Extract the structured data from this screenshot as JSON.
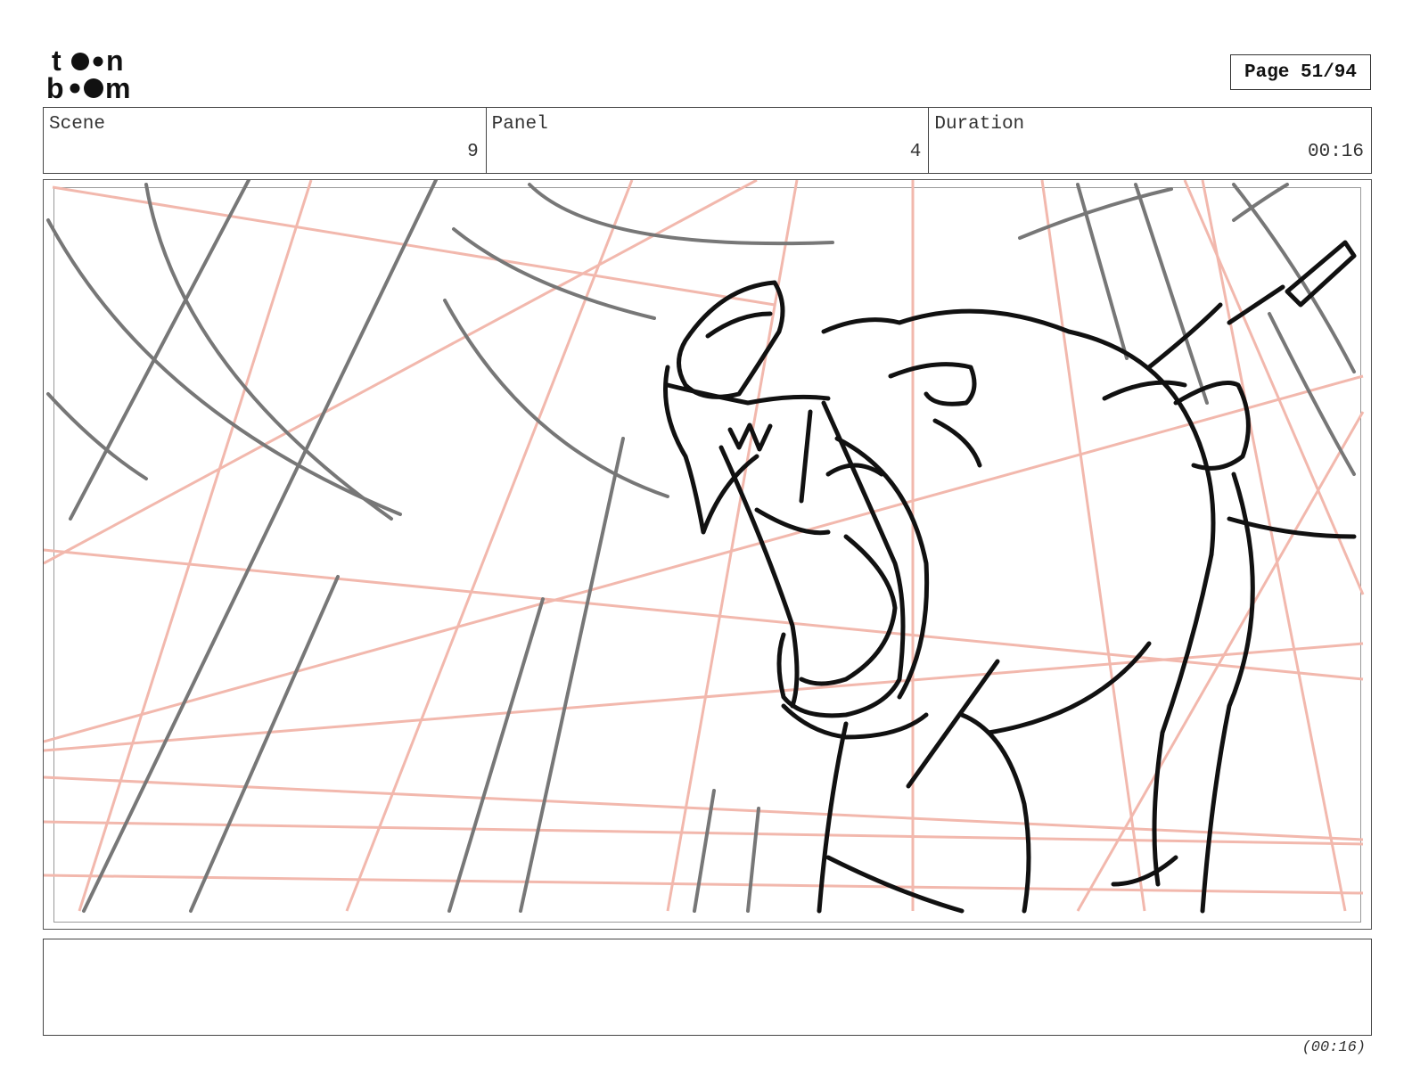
{
  "logo": {
    "line1": "toon",
    "line2": "boom"
  },
  "page": {
    "label": "Page 51/94"
  },
  "info": {
    "scene_label": "Scene",
    "scene_value": "9",
    "panel_label": "Panel",
    "panel_value": "4",
    "duration_label": "Duration",
    "duration_value": "00:16"
  },
  "notes": {
    "text": ""
  },
  "footer": {
    "duration": "(00:16)"
  },
  "colors": {
    "construction_lines": "#f2b8ad",
    "rough_lines": "#777777",
    "ink": "#111111"
  }
}
